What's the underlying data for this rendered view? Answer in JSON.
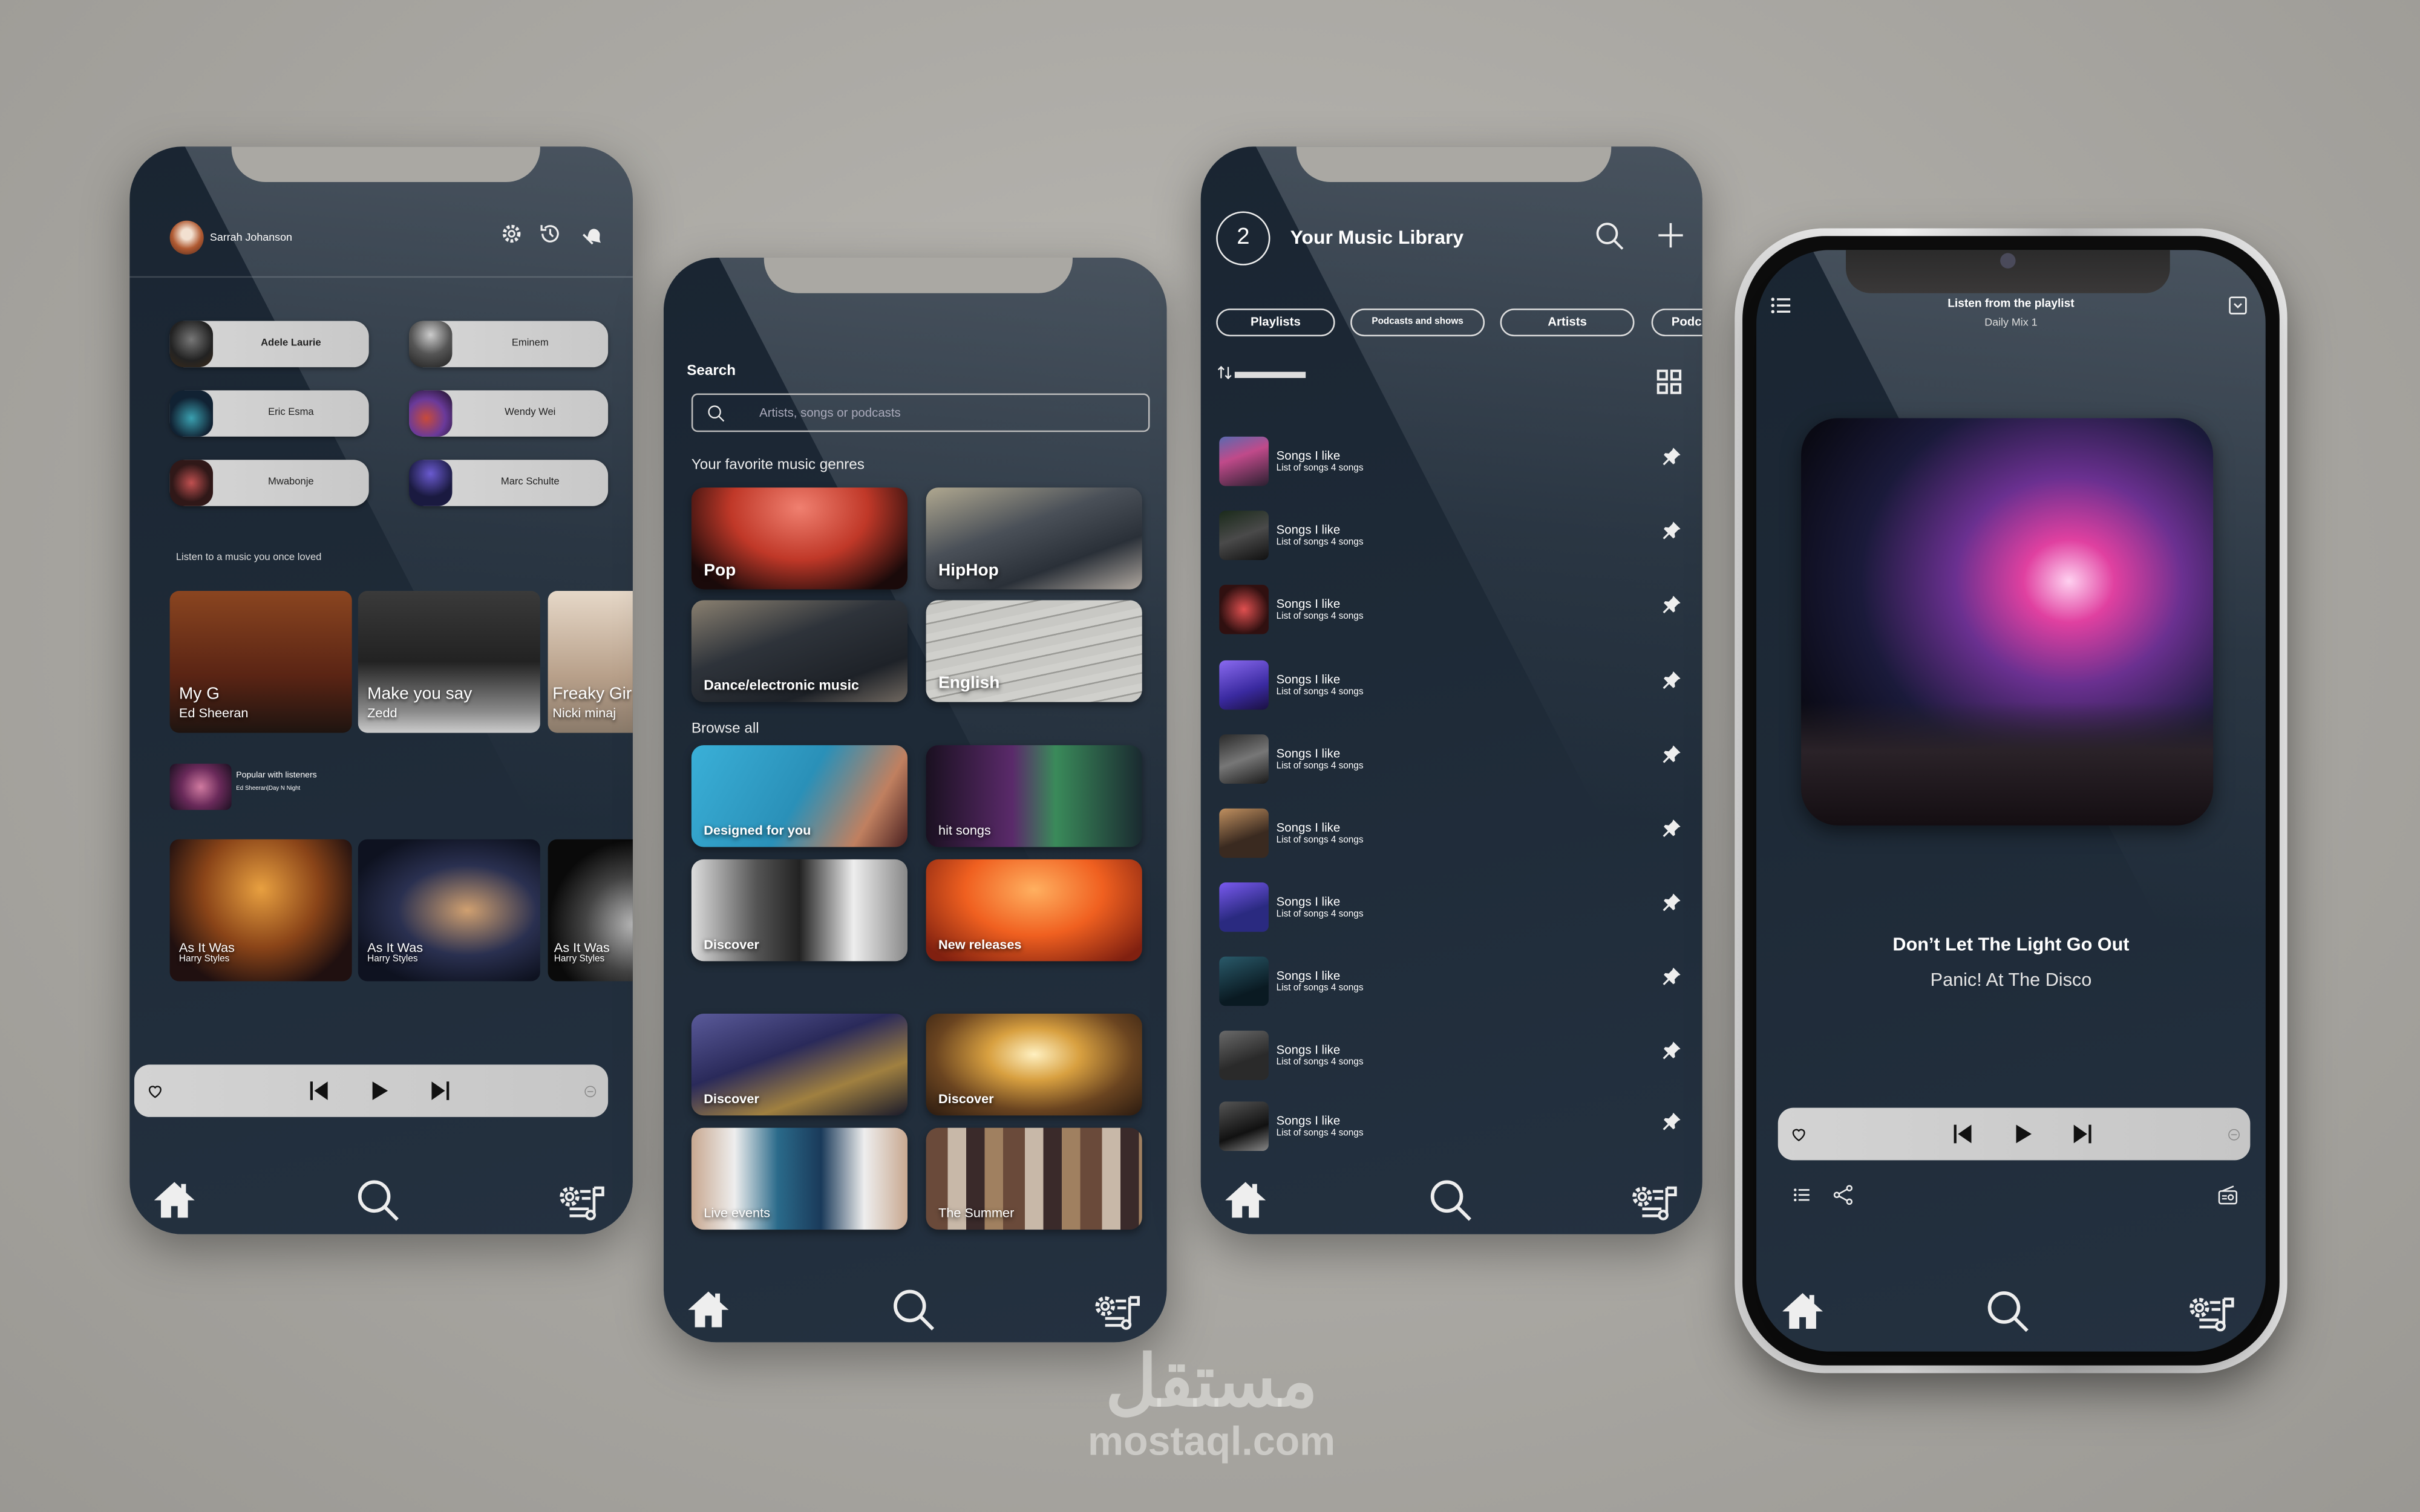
{
  "phone_home": {
    "user_name": "Sarrah Johanson",
    "artists": [
      "Adele Laurie",
      "Eminem",
      "Eric Esma",
      "Wendy Wei",
      "Mwabonje",
      "Marc Schulte"
    ],
    "section_title": "Listen to a music you once loved",
    "recent": [
      {
        "title": "My G",
        "artist": "Ed Sheeran"
      },
      {
        "title": "Make you say",
        "artist": "Zedd"
      },
      {
        "title": "Freaky Gir",
        "artist": "Nicki minaj"
      }
    ],
    "popular": {
      "title": "Popular with listeners",
      "subtitle": "Ed Sheeran|Day N Night"
    },
    "more": [
      {
        "title": "As It Was",
        "artist": "Harry Styles"
      },
      {
        "title": "As It Was",
        "artist": "Harry Styles"
      },
      {
        "title": "As It Was",
        "artist": "Harry Styles"
      }
    ]
  },
  "phone_search": {
    "title": "Search",
    "placeholder": "Artists, songs or podcasts",
    "genres_title": "Your favorite music genres",
    "genres": [
      "Pop",
      "HipHop",
      "Dance/electronic music",
      "English"
    ],
    "browse_title": "Browse all",
    "browse": [
      "Designed for you",
      "hit songs",
      "Discover",
      "New releases",
      "Discover",
      "Discover",
      "Live events",
      "The Summer"
    ]
  },
  "phone_library": {
    "badge": "2",
    "title": "Your Music Library",
    "chips": [
      "Playlists",
      "Podcasts and shows",
      "Artists",
      "Podc"
    ],
    "items": [
      {
        "title": "Songs I like",
        "subtitle": "List of songs 4 songs"
      },
      {
        "title": "Songs I like",
        "subtitle": "List of songs 4 songs"
      },
      {
        "title": "Songs I like",
        "subtitle": "List of songs 4 songs"
      },
      {
        "title": "Songs I like",
        "subtitle": "List of songs 4 songs"
      },
      {
        "title": "Songs I like",
        "subtitle": "List of songs 4 songs"
      },
      {
        "title": "Songs I like",
        "subtitle": "List of songs 4 songs"
      },
      {
        "title": "Songs I like",
        "subtitle": "List of songs 4 songs"
      },
      {
        "title": "Songs I like",
        "subtitle": "List of songs 4 songs"
      },
      {
        "title": "Songs I like",
        "subtitle": "List of songs 4 songs"
      },
      {
        "title": "Songs I like",
        "subtitle": "List of songs 4 songs"
      }
    ]
  },
  "phone_player": {
    "header_title": "Listen from the playlist",
    "header_subtitle": "Daily Mix 1",
    "song_title": "Don’t Let The Light Go Out",
    "artist": "Panic! At The Disco"
  },
  "watermark": {
    "arabic": "مستقل",
    "latin": "mostaql.com"
  },
  "colors": {
    "screen_bg": "#1e2a37",
    "player_bar": "#cccccc",
    "page_bg": "#a9a7a2"
  }
}
